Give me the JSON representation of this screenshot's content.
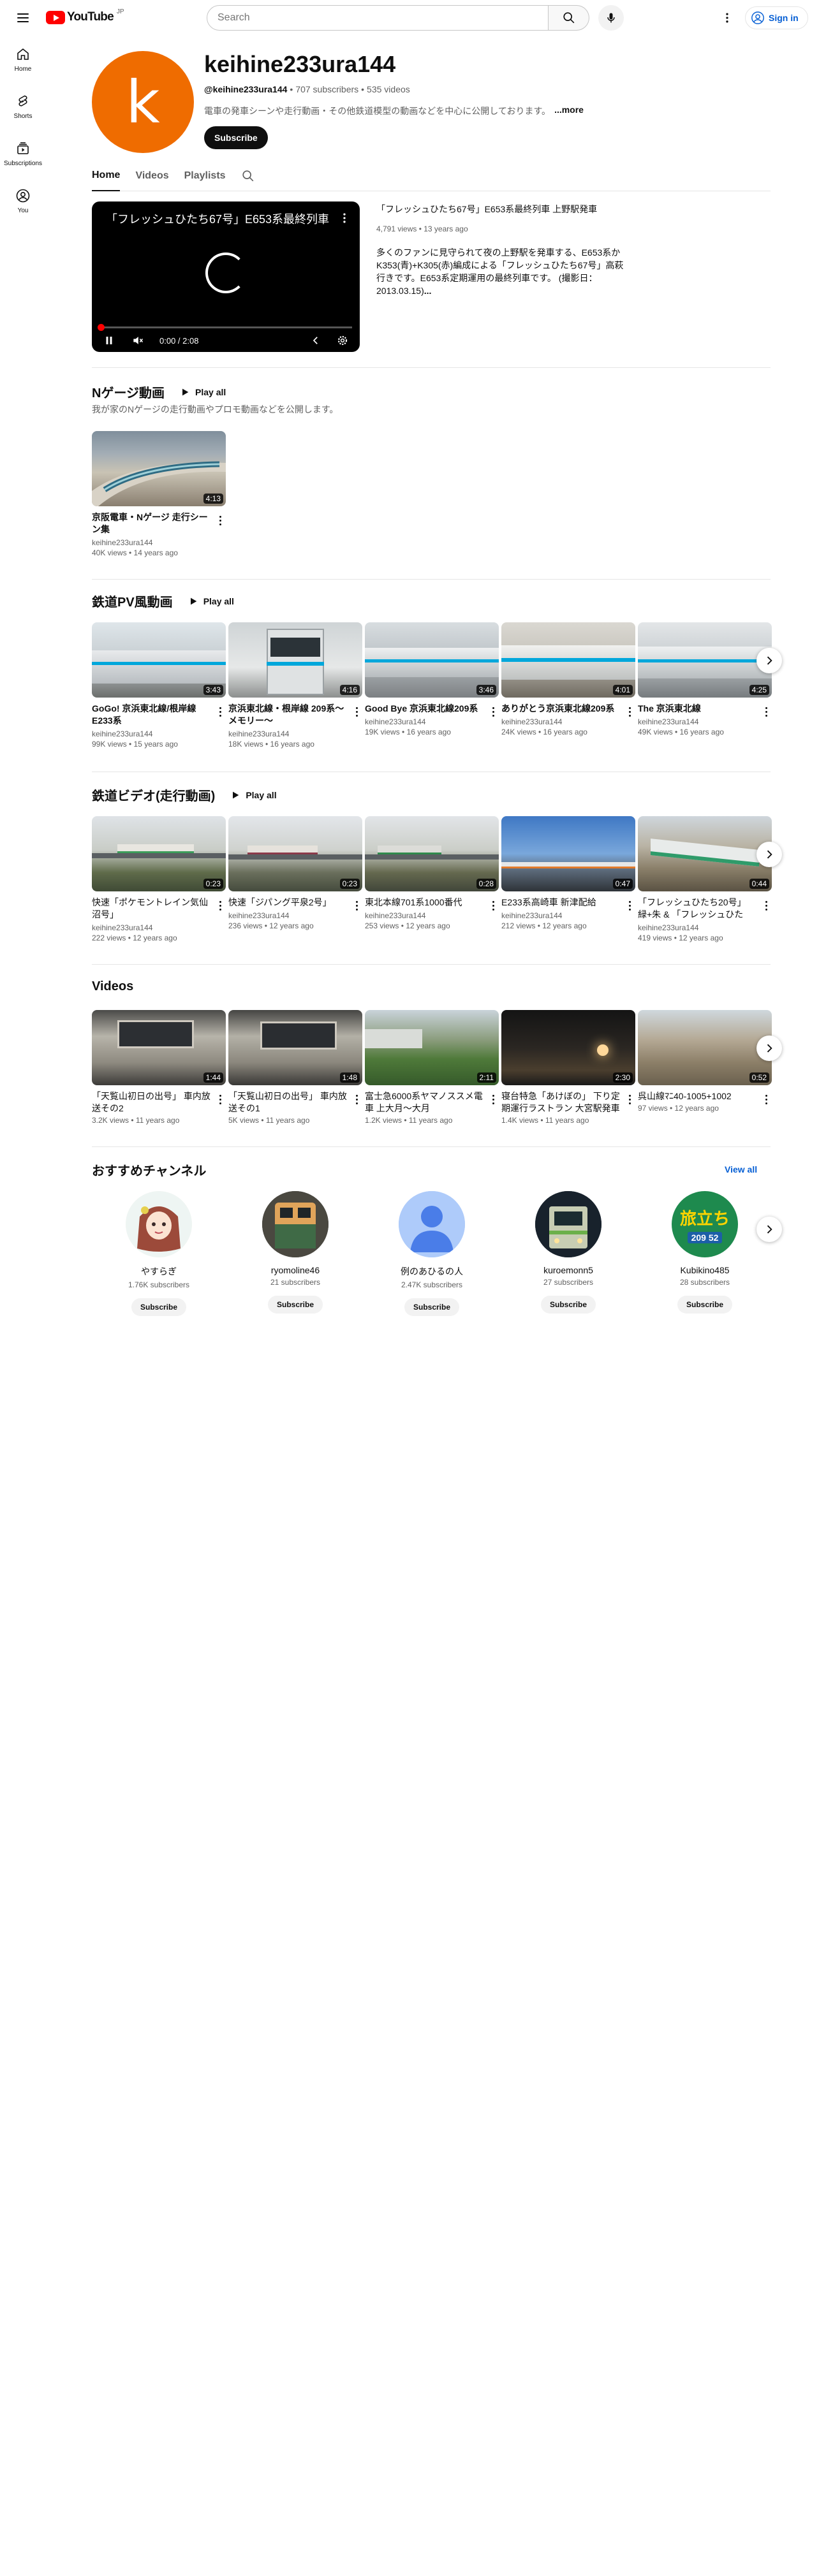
{
  "header": {
    "logo_text": "YouTube",
    "logo_region": "JP",
    "search_placeholder": "Search",
    "sign_in_label": "Sign in"
  },
  "guide": [
    {
      "label": "Home",
      "icon": "home-icon"
    },
    {
      "label": "Shorts",
      "icon": "shorts-icon"
    },
    {
      "label": "Subscriptions",
      "icon": "subscriptions-icon"
    },
    {
      "label": "You",
      "icon": "you-icon"
    }
  ],
  "channel": {
    "avatar_letter": "k",
    "avatar_color": "#ef6c00",
    "name": "keihine233ura144",
    "handle": "@keihine233ura144",
    "subscribers": "707 subscribers",
    "videos": "535 videos",
    "description": "電車の発車シーンや走行動画・その他鉄道模型の動画などを中心に公開しております。",
    "more_label": "...more",
    "subscribe_label": "Subscribe"
  },
  "tabs": [
    {
      "label": "Home",
      "active": true
    },
    {
      "label": "Videos",
      "active": false
    },
    {
      "label": "Playlists",
      "active": false
    }
  ],
  "featured": {
    "player_title": "「フレッシュひたち67号」E653系最終列車 上野駅発車",
    "time_display": "0:00 / 2:08",
    "progress": 0,
    "title": "「フレッシュひたち67号」E653系最終列車 上野駅発車",
    "meta": "4,791 views • 13 years ago",
    "description": "多くのファンに見守られて夜の上野駅を発車する、E653系か K353(青)+K305(赤)編成による「フレッシュひたち67号」高萩行きです。E653系定期運用の最終列車です。 (撮影日：2013.03.15)",
    "more_label": "..."
  },
  "shelves": {
    "n_gauge": {
      "title": "Nゲージ動画",
      "play_all": "Play all",
      "subtitle": "我が家のNゲージの走行動画やプロモ動画などを公開します。",
      "videos": [
        {
          "title": "京阪電車・Nゲージ 走行シーン集",
          "duration": "4:13",
          "channel": "keihine233ura144",
          "stats": "40K views • 14 years ago"
        }
      ]
    },
    "pv": {
      "title": "鉄道PV風動画",
      "play_all": "Play all",
      "videos": [
        {
          "title": "GoGo! 京浜東北線/根岸線E233系",
          "duration": "3:43",
          "channel": "keihine233ura144",
          "stats": "99K views • 15 years ago"
        },
        {
          "title": "京浜東北線・根岸線 209系〜メモリー〜",
          "duration": "4:16",
          "channel": "keihine233ura144",
          "stats": "18K views • 16 years ago"
        },
        {
          "title": "Good Bye 京浜東北線209系",
          "duration": "3:46",
          "channel": "keihine233ura144",
          "stats": "19K views • 16 years ago"
        },
        {
          "title": "ありがとう京浜東北線209系",
          "duration": "4:01",
          "channel": "keihine233ura144",
          "stats": "24K views • 16 years ago"
        },
        {
          "title": "The 京浜東北線",
          "duration": "4:25",
          "channel": "keihine233ura144",
          "stats": "49K views • 16 years ago"
        }
      ]
    },
    "rail_video": {
      "title": "鉄道ビデオ(走行動画)",
      "play_all": "Play all",
      "videos": [
        {
          "title": "快速「ポケモントレイン気仙沼号」",
          "duration": "0:23",
          "channel": "keihine233ura144",
          "stats": "222 views • 12 years ago"
        },
        {
          "title": "快速「ジパング平泉2号」",
          "duration": "0:23",
          "channel": "keihine233ura144",
          "stats": "236 views • 12 years ago"
        },
        {
          "title": "東北本線701系1000番代",
          "duration": "0:28",
          "channel": "keihine233ura144",
          "stats": "253 views • 12 years ago"
        },
        {
          "title": "E233系高崎車 新津配給",
          "duration": "0:47",
          "channel": "keihine233ura144",
          "stats": "212 views • 12 years ago"
        },
        {
          "title": "「フレッシュひたち20号」 緑+朱 & 「フレッシュひたち...",
          "duration": "0:44",
          "channel": "keihine233ura144",
          "stats": "419 views • 12 years ago"
        }
      ]
    },
    "videos": {
      "title": "Videos",
      "videos": [
        {
          "title": "「天覧山初日の出号」 車内放送その2",
          "duration": "1:44",
          "stats": "3.2K views • 11 years ago"
        },
        {
          "title": "「天覧山初日の出号」 車内放送その1",
          "duration": "1:48",
          "stats": "5K views • 11 years ago"
        },
        {
          "title": "富士急6000系ヤマノススメ電車 上大月〜大月",
          "duration": "2:11",
          "stats": "1.2K views • 11 years ago"
        },
        {
          "title": "寝台特急「あけぼの」 下り定期運行ラストラン 大宮駅発車",
          "duration": "2:30",
          "stats": "1.4K views • 11 years ago"
        },
        {
          "title": "呉山線ﾏﾆ40-1005+1002",
          "duration": "0:52",
          "stats": "97 views • 12 years ago"
        }
      ]
    },
    "channels": {
      "title": "おすすめチャンネル",
      "view_all": "View all",
      "items": [
        {
          "name": "やすらぎ",
          "subs": "1.76K subscribers",
          "subscribe": "Subscribe"
        },
        {
          "name": "ryomoline46",
          "subs": "21 subscribers",
          "subscribe": "Subscribe"
        },
        {
          "name": "例のあひるの人",
          "subs": "2.47K subscribers",
          "subscribe": "Subscribe"
        },
        {
          "name": "kuroemonn5",
          "subs": "27 subscribers",
          "subscribe": "Subscribe"
        },
        {
          "name": "Kubikino485",
          "subs": "28 subscribers",
          "subscribe": "Subscribe"
        }
      ],
      "badge_text": "旅立ち",
      "badge_number": "209 52"
    }
  },
  "colors": {
    "brand_red": "#ff0000",
    "link_blue": "#065fd4",
    "jr_blue_line": "#00a7db"
  }
}
